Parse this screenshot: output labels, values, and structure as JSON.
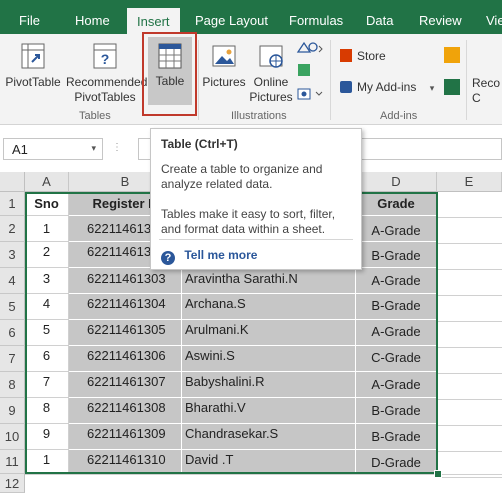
{
  "tabs": [
    "File",
    "Home",
    "Insert",
    "Page Layout",
    "Formulas",
    "Data",
    "Review",
    "Vie"
  ],
  "ribbon": {
    "pivot_table": "PivotTable",
    "recommended_line1": "Recommended",
    "recommended_line2": "PivotTables",
    "table": "Table",
    "tables_group": "Tables",
    "pictures": "Pictures",
    "online_line1": "Online",
    "online_line2": "Pictures",
    "illustrations_group": "Illustrations",
    "store": "Store",
    "my_addins": "My Add-ins",
    "addins_group": "Add-ins",
    "reco_line1": "Reco",
    "reco_line2": "C"
  },
  "name_box": "A1",
  "tooltip": {
    "title": "Table (Ctrl+T)",
    "line1": "Create a table to organize and",
    "line2": "analyze related data.",
    "line3": "Tables make it easy to sort, filter,",
    "line4": "and format data within a sheet.",
    "help_link": "Tell me more"
  },
  "sheet": {
    "columns": [
      "A",
      "B",
      "C",
      "D",
      "E"
    ],
    "row_numbers": [
      "1",
      "2",
      "3",
      "4",
      "5",
      "6",
      "7",
      "8",
      "9",
      "10",
      "11",
      "12"
    ],
    "headers": {
      "sno": "Sno",
      "register": "Register N",
      "grade": "Grade"
    },
    "rows": [
      {
        "sno": "1",
        "reg": "62211461301",
        "name": "",
        "grade": "A-Grade"
      },
      {
        "sno": "2",
        "reg": "62211461302",
        "name": "",
        "grade": "B-Grade"
      },
      {
        "sno": "3",
        "reg": "62211461303",
        "name": "Aravintha Sarathi.N",
        "grade": "A-Grade"
      },
      {
        "sno": "4",
        "reg": "62211461304",
        "name": "Archana.S",
        "grade": "B-Grade"
      },
      {
        "sno": "5",
        "reg": "62211461305",
        "name": "Arulmani.K",
        "grade": "A-Grade"
      },
      {
        "sno": "6",
        "reg": "62211461306",
        "name": "Aswini.S",
        "grade": "C-Grade"
      },
      {
        "sno": "7",
        "reg": "62211461307",
        "name": "Babyshalini.R",
        "grade": "A-Grade"
      },
      {
        "sno": "8",
        "reg": "62211461308",
        "name": "Bharathi.V",
        "grade": "B-Grade"
      },
      {
        "sno": "9",
        "reg": "62211461309",
        "name": "Chandrasekar.S",
        "grade": "B-Grade"
      },
      {
        "sno": "1",
        "reg": "62211461310",
        "name": "David .T",
        "grade": "D-Grade"
      }
    ]
  },
  "colors": {
    "excel_green": "#217346",
    "highlight_red": "#c0392b",
    "table_fill": "#c6c6c6",
    "link_blue": "#2b579a"
  }
}
